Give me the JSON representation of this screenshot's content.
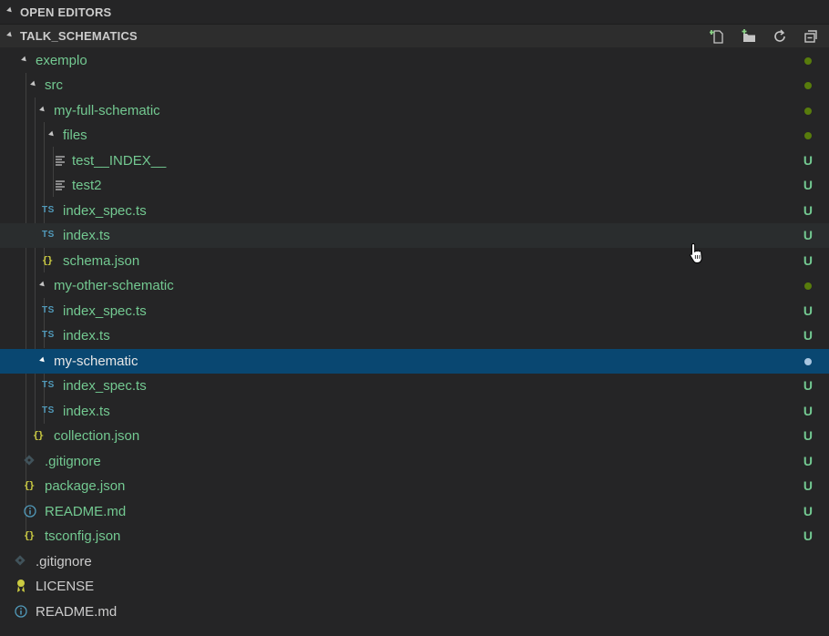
{
  "sections": {
    "open_editors": "OPEN EDITORS",
    "project": "TALK_SCHEMATICS"
  },
  "toolbar": [
    "new-file-icon",
    "new-folder-icon",
    "refresh-icon",
    "collapse-all-icon"
  ],
  "tree": [
    {
      "label": "exemplo",
      "type": "folder",
      "badge": "dot"
    },
    {
      "label": "src",
      "type": "folder",
      "badge": "dot"
    },
    {
      "label": "my-full-schematic",
      "type": "folder",
      "badge": "dot"
    },
    {
      "label": "files",
      "type": "folder",
      "badge": "dot"
    },
    {
      "label": "test__INDEX__",
      "type": "file",
      "icon": "lines-icon",
      "badge": "U"
    },
    {
      "label": "test2",
      "type": "file",
      "icon": "lines-icon",
      "badge": "U"
    },
    {
      "label": "index_spec.ts",
      "type": "file",
      "icon": "TS",
      "badge": "U"
    },
    {
      "label": "index.ts",
      "type": "file",
      "icon": "TS",
      "badge": "U"
    },
    {
      "label": "schema.json",
      "type": "file",
      "icon": "{}",
      "badge": "U"
    },
    {
      "label": "my-other-schematic",
      "type": "folder",
      "badge": "dot"
    },
    {
      "label": "index_spec.ts",
      "type": "file",
      "icon": "TS",
      "badge": "U"
    },
    {
      "label": "index.ts",
      "type": "file",
      "icon": "TS",
      "badge": "U"
    },
    {
      "label": "my-schematic",
      "type": "folder",
      "badge": "dot"
    },
    {
      "label": "index_spec.ts",
      "type": "file",
      "icon": "TS",
      "badge": "U"
    },
    {
      "label": "index.ts",
      "type": "file",
      "icon": "TS",
      "badge": "U"
    },
    {
      "label": "collection.json",
      "type": "file",
      "icon": "{}",
      "badge": "U"
    },
    {
      "label": ".gitignore",
      "type": "file",
      "icon": "git-icon",
      "badge": "U"
    },
    {
      "label": "package.json",
      "type": "file",
      "icon": "{}",
      "badge": "U"
    },
    {
      "label": "README.md",
      "type": "file",
      "icon": "info-icon",
      "badge": "U"
    },
    {
      "label": "tsconfig.json",
      "type": "file",
      "icon": "{}",
      "badge": "U"
    },
    {
      "label": ".gitignore",
      "type": "file",
      "icon": "git-icon"
    },
    {
      "label": "LICENSE",
      "type": "file",
      "icon": "license-icon"
    },
    {
      "label": "README.md",
      "type": "file",
      "icon": "info-icon"
    }
  ],
  "colors": {
    "background": "#252526",
    "selected": "#094771",
    "hover": "#2a2d2e",
    "untracked": "#73c991",
    "ts_icon": "#519aba",
    "json_icon": "#cbcb41"
  }
}
